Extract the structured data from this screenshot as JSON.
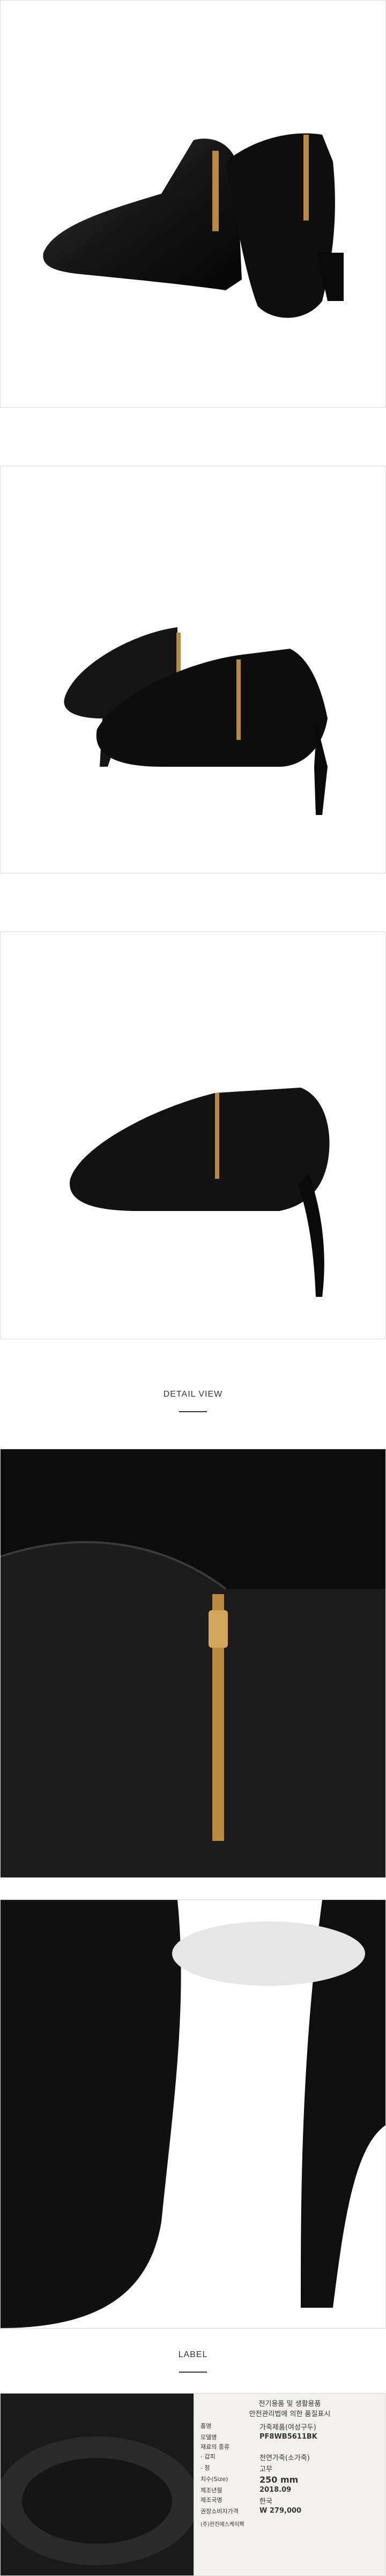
{
  "sections": {
    "detail_title": "DETAIL VIEW",
    "label_title": "LABEL"
  },
  "label": {
    "header_line1": "전기용품 및 생활용품",
    "header_line2": "안전관리법에 의한 품질표시",
    "rows": [
      {
        "key": "품명",
        "value": "가죽제품(여성구두)"
      },
      {
        "key": "모델명",
        "value": "PF8WB5611BK"
      },
      {
        "key": "재료의 종류",
        "value": ""
      },
      {
        "key": "- 갑피",
        "value": "천연가죽(소가죽)"
      },
      {
        "key": "- 창",
        "value": "고무"
      },
      {
        "key": "치수(Size)",
        "value": "250 mm"
      },
      {
        "key": "제조년월",
        "value": "2018.09"
      },
      {
        "key": "제조국명",
        "value": "한국"
      },
      {
        "key": "권장소비자가격",
        "value": "W 279,000"
      }
    ],
    "footer": "(주)한진에스케이팩"
  },
  "colors": {
    "leather": "#161616",
    "zipper_gold": "#b8893f",
    "panel_border": "#dcdcdc",
    "background": "#ffffff"
  }
}
